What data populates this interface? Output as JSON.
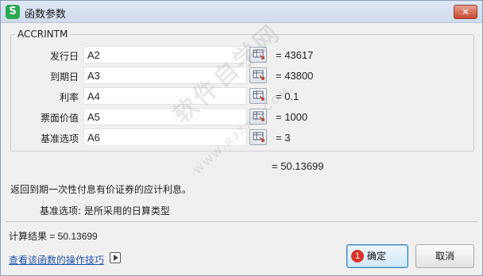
{
  "window": {
    "title": "函数参数",
    "app_icon_letter": "S",
    "close_glyph": "✕"
  },
  "function": {
    "name": "ACCRINTM",
    "args": [
      {
        "label": "发行日",
        "value": "A2",
        "result": "= 43617"
      },
      {
        "label": "到期日",
        "value": "A3",
        "result": "= 43800"
      },
      {
        "label": "利率",
        "value": "A4",
        "result": "= 0.1"
      },
      {
        "label": "票面价值",
        "value": "A5",
        "result": "= 1000"
      },
      {
        "label": "基准选项",
        "value": "A6",
        "result": "= 3"
      }
    ],
    "result_line": "= 50.13699",
    "description": "返回到期一次性付息有价证券的应计利息。",
    "arg_description": "基准选项:  是所采用的日算类型"
  },
  "footer": {
    "calc_result": "计算结果 =  50.13699",
    "help_link": "查看该函数的操作技巧",
    "ok_label": "确定",
    "ok_badge": "1",
    "cancel_label": "取消"
  },
  "watermark": {
    "main": "软件自学网",
    "sub": "WWW.RJZXW.COM"
  },
  "icons": {
    "app": "wps-spreadsheet-icon",
    "close": "close-icon",
    "range_picker": "range-picker-icon",
    "video": "video-play-icon"
  },
  "colors": {
    "app_icon": "#2aa952",
    "close_button": "#c94a31",
    "link": "#2255aa",
    "badge": "#d9332b",
    "ok_border": "#3c7fb1"
  }
}
